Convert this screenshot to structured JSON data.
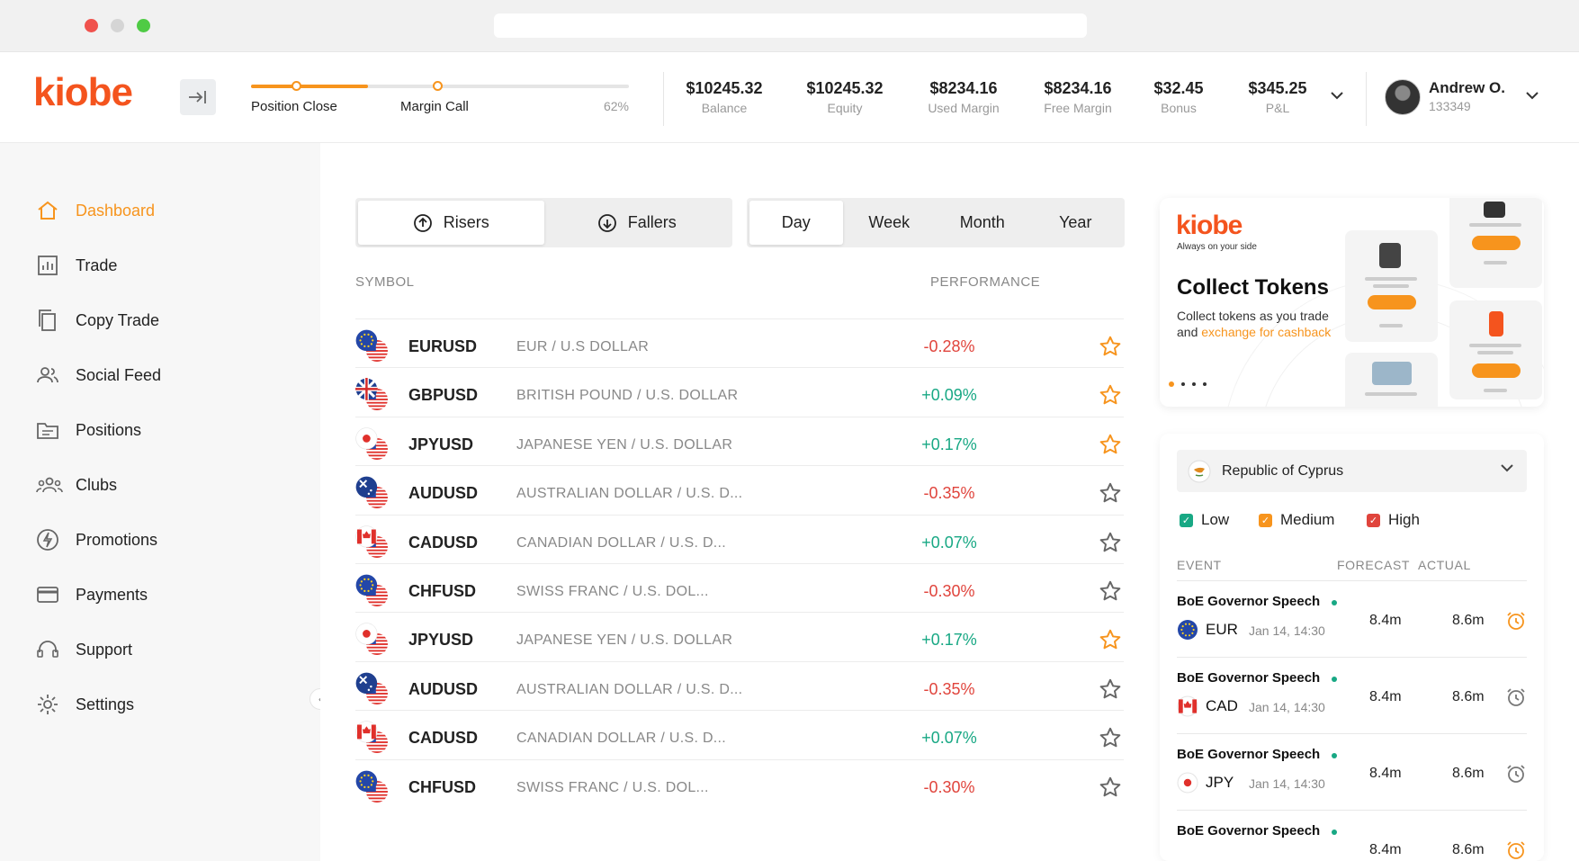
{
  "brand": {
    "logo": "kiobe",
    "accent": "#f7941d",
    "logo_color": "#f4541e"
  },
  "header": {
    "margin_meter": {
      "left_label": "Position Close",
      "mid_label": "Margin Call",
      "percent_label": "62%",
      "fill_fraction": 0.62
    },
    "stats": [
      {
        "value": "$10245.32",
        "label": "Balance"
      },
      {
        "value": "$10245.32",
        "label": "Equity"
      },
      {
        "value": "$8234.16",
        "label": "Used Margin"
      },
      {
        "value": "$8234.16",
        "label": "Free Margin"
      },
      {
        "value": "$32.45",
        "label": "Bonus"
      },
      {
        "value": "$345.25",
        "label": "P&L"
      }
    ],
    "user": {
      "name": "Andrew O.",
      "id": "133349"
    }
  },
  "sidebar": {
    "items": [
      {
        "label": "Dashboard",
        "icon": "home-icon",
        "active": true
      },
      {
        "label": "Trade",
        "icon": "chart-icon"
      },
      {
        "label": "Copy Trade",
        "icon": "copy-icon"
      },
      {
        "label": "Social Feed",
        "icon": "users-icon"
      },
      {
        "label": "Positions",
        "icon": "folder-icon"
      },
      {
        "label": "Clubs",
        "icon": "group-icon"
      },
      {
        "label": "Promotions",
        "icon": "bolt-icon"
      },
      {
        "label": "Payments",
        "icon": "card-icon"
      },
      {
        "label": "Support",
        "icon": "headset-icon"
      },
      {
        "label": "Settings",
        "icon": "gear-icon"
      }
    ]
  },
  "market": {
    "movement_tabs": [
      {
        "label": "Risers",
        "selected": true
      },
      {
        "label": "Fallers"
      }
    ],
    "period_tabs": [
      {
        "label": "Day",
        "selected": true
      },
      {
        "label": "Week"
      },
      {
        "label": "Month"
      },
      {
        "label": "Year"
      }
    ],
    "columns": {
      "symbol": "SYMBOL",
      "performance": "PERFORMANCE"
    },
    "rows": [
      {
        "symbol": "EURUSD",
        "desc": "EUR / U.S DOLLAR",
        "perf": "-0.28%",
        "dir": "neg",
        "fav": true,
        "base": "eu"
      },
      {
        "symbol": "GBPUSD",
        "desc": "BRITISH POUND / U.S. DOLLAR",
        "perf": "+0.09%",
        "dir": "pos",
        "fav": true,
        "base": "gb"
      },
      {
        "symbol": "JPYUSD",
        "desc": "JAPANESE YEN / U.S. DOLLAR",
        "perf": "+0.17%",
        "dir": "pos",
        "fav": true,
        "base": "jp"
      },
      {
        "symbol": "AUDUSD",
        "desc": "AUSTRALIAN DOLLAR / U.S. D...",
        "perf": "-0.35%",
        "dir": "neg",
        "fav": false,
        "base": "au"
      },
      {
        "symbol": "CADUSD",
        "desc": "CANADIAN DOLLAR / U.S. D...",
        "perf": "+0.07%",
        "dir": "pos",
        "fav": false,
        "base": "ca"
      },
      {
        "symbol": "CHFUSD",
        "desc": "SWISS FRANC / U.S. DOL...",
        "perf": "-0.30%",
        "dir": "neg",
        "fav": false,
        "base": "eu"
      },
      {
        "symbol": "JPYUSD",
        "desc": "JAPANESE YEN / U.S. DOLLAR",
        "perf": "+0.17%",
        "dir": "pos",
        "fav": true,
        "base": "jp"
      },
      {
        "symbol": "AUDUSD",
        "desc": "AUSTRALIAN DOLLAR / U.S. D...",
        "perf": "-0.35%",
        "dir": "neg",
        "fav": false,
        "base": "au"
      },
      {
        "symbol": "CADUSD",
        "desc": "CANADIAN DOLLAR / U.S. D...",
        "perf": "+0.07%",
        "dir": "pos",
        "fav": false,
        "base": "ca"
      },
      {
        "symbol": "CHFUSD",
        "desc": "SWISS FRANC / U.S. DOL...",
        "perf": "-0.30%",
        "dir": "neg",
        "fav": false,
        "base": "eu"
      }
    ]
  },
  "promo": {
    "logo": "kiobe",
    "tagline": "Always on your side",
    "title": "Collect Tokens",
    "text_a": "Collect tokens as you trade and ",
    "text_link": "exchange for cashback",
    "slides": 4,
    "active_slide": 0
  },
  "calendar": {
    "country": "Republic of Cyprus",
    "filters": [
      {
        "label": "Low",
        "color": "#18a884"
      },
      {
        "label": "Medium",
        "color": "#f7941d"
      },
      {
        "label": "High",
        "color": "#e0443c"
      }
    ],
    "columns": {
      "event": "EVENT",
      "forecast": "FORECAST",
      "actual": "ACTUAL"
    },
    "events": [
      {
        "name": "BoE Governor Speech",
        "currency": "EUR",
        "date": "Jan 14, 14:30",
        "forecast": "8.4m",
        "actual": "8.6m",
        "alarm_on": true,
        "flag": "eu"
      },
      {
        "name": "BoE Governor Speech",
        "currency": "CAD",
        "date": "Jan 14, 14:30",
        "forecast": "8.4m",
        "actual": "8.6m",
        "alarm_on": false,
        "flag": "ca"
      },
      {
        "name": "BoE Governor Speech",
        "currency": "JPY",
        "date": "Jan 14, 14:30",
        "forecast": "8.4m",
        "actual": "8.6m",
        "alarm_on": false,
        "flag": "jp"
      },
      {
        "name": "BoE Governor Speech",
        "currency": "",
        "date": "",
        "forecast": "8.4m",
        "actual": "8.6m",
        "alarm_on": true,
        "flag": ""
      }
    ]
  }
}
